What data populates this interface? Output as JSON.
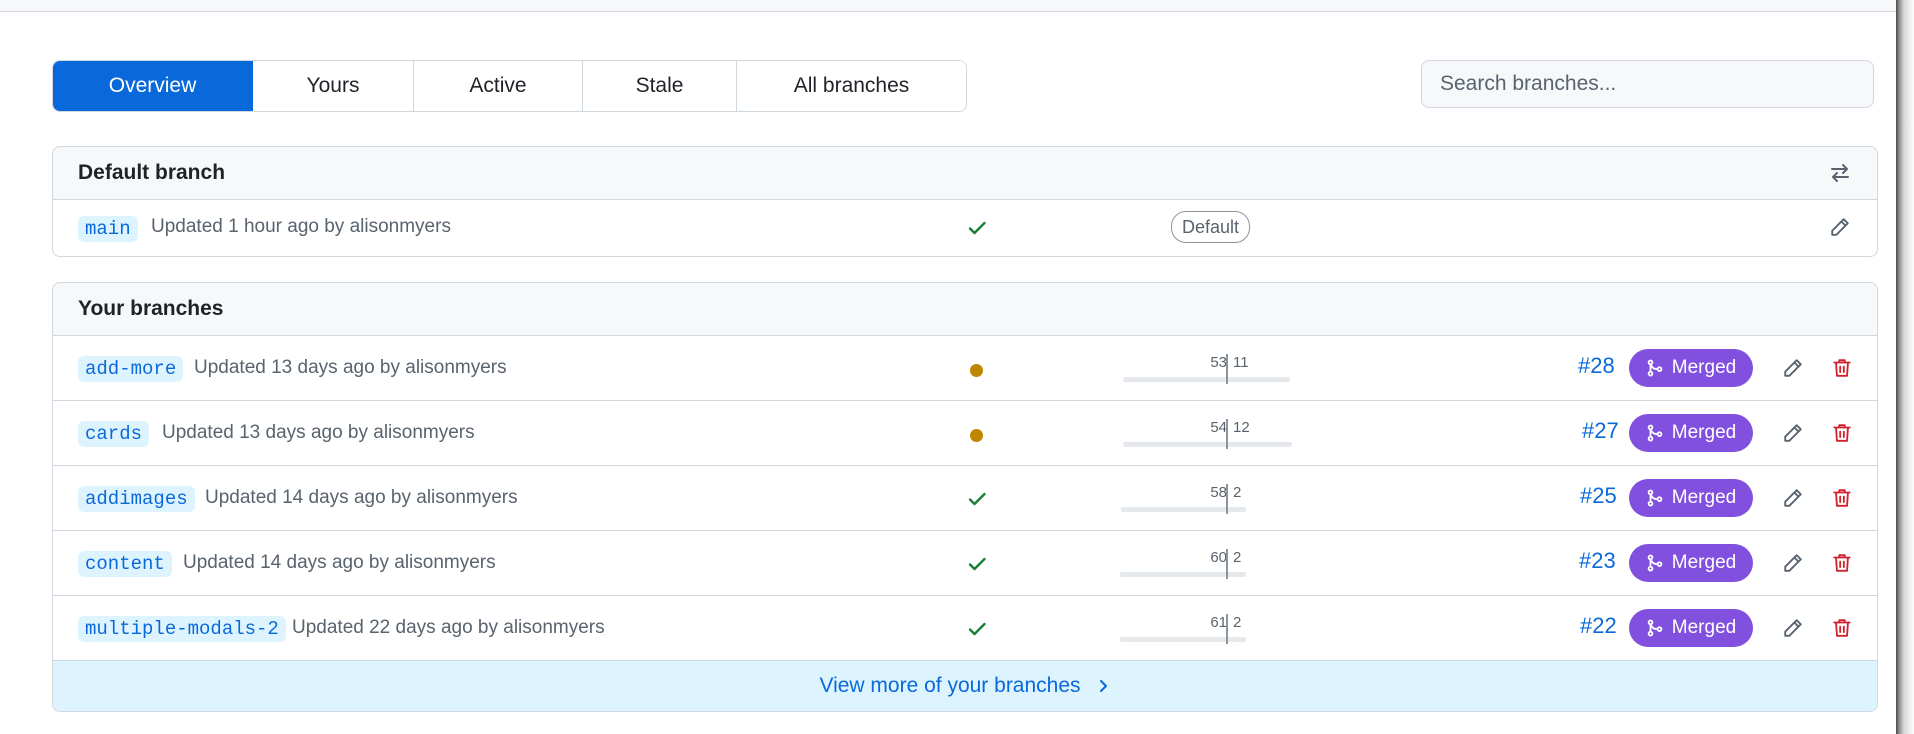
{
  "tabs": [
    "Overview",
    "Yours",
    "Active",
    "Stale",
    "All branches"
  ],
  "search": {
    "placeholder": "Search branches..."
  },
  "default_branch": {
    "title": "Default branch",
    "name": "main",
    "updated": "Updated 1 hour ago by alisonmyers",
    "label": "Default"
  },
  "your_branches": {
    "title": "Your branches",
    "merged_label": "Merged",
    "rows": [
      {
        "name": "add-more",
        "updated": "Updated 13 days ago by alisonmyers",
        "status": "pending",
        "behind": "53",
        "ahead": "11",
        "pr": "#28"
      },
      {
        "name": "cards",
        "updated": "Updated 13 days ago by alisonmyers",
        "status": "pending",
        "behind": "54",
        "ahead": "12",
        "pr": "#27"
      },
      {
        "name": "addimages",
        "updated": "Updated 14 days ago by alisonmyers",
        "status": "success",
        "behind": "58",
        "ahead": "2",
        "pr": "#25"
      },
      {
        "name": "content",
        "updated": "Updated 14 days ago by alisonmyers",
        "status": "success",
        "behind": "60",
        "ahead": "2",
        "pr": "#23"
      },
      {
        "name": "multiple-modals-2",
        "updated": "Updated 22 days ago by alisonmyers",
        "status": "success",
        "behind": "61",
        "ahead": "2",
        "pr": "#22"
      }
    ],
    "view_more": "View more of your branches"
  },
  "colors": {
    "accent": "#0969da",
    "merged": "#8250df",
    "success": "#1a7f37",
    "pending": "#bf8700",
    "danger": "#cf222e"
  },
  "icons": [
    "arrow-switch-icon",
    "pencil-icon",
    "trash-icon",
    "check-icon",
    "git-merge-icon",
    "chevron-right-icon"
  ]
}
